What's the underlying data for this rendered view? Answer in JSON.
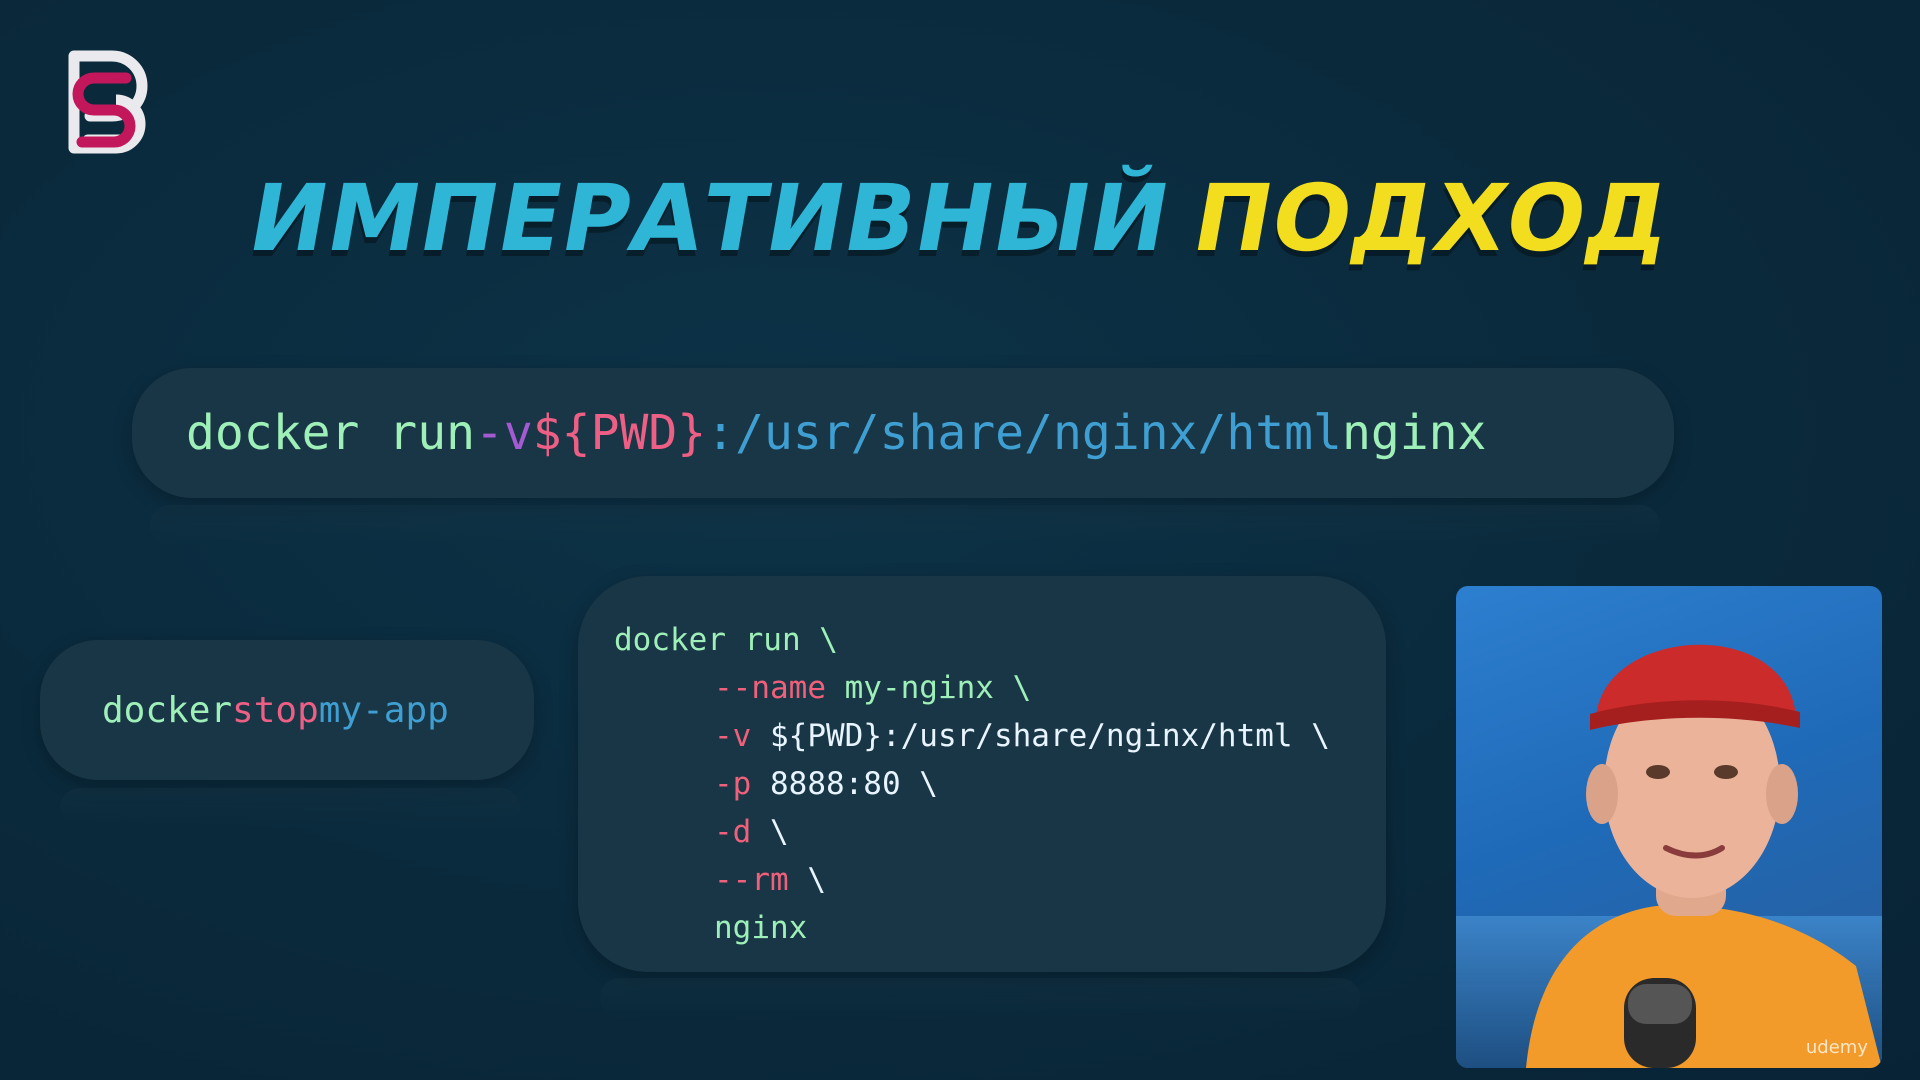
{
  "title": {
    "part1": "ИМПЕРАТИВНЫЙ",
    "part2": "ПОДХОД"
  },
  "command_main": {
    "t1": "docker run",
    "t2": "-v",
    "t3": "${PWD}",
    "t4": ":/usr/share/nginx/html",
    "t5": "nginx"
  },
  "command_stop": {
    "t1": "docker",
    "t2": "stop",
    "t3": "my-app"
  },
  "code_block": {
    "line1": "docker run \\",
    "line2_flag": "--name",
    "line2_rest": " my-nginx \\",
    "line3_flag": "-v",
    "line3_rest": " ${PWD}:/usr/share/nginx/html \\",
    "line4_flag": "-p",
    "line4_rest": " 8888:80 \\",
    "line5_flag": "-d",
    "line5_rest": " \\",
    "line6_flag": "--rm",
    "line6_rest": " \\",
    "line7": "nginx"
  },
  "watermark": "udemy",
  "colors": {
    "background": "#0a2a3c",
    "title_cyan": "#2fb6d6",
    "title_yellow": "#f2de1e",
    "code_green": "#9ff0b8",
    "code_pink": "#ee5f86",
    "code_purple": "#a45ad2",
    "code_blue": "#3f9fd2"
  },
  "icons": {
    "logo": "brand-logo"
  }
}
